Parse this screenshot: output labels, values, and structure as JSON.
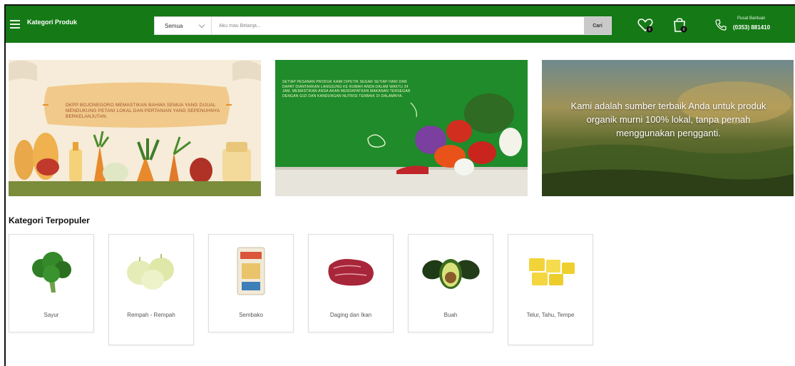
{
  "header": {
    "menu_label": "Kategori Produk",
    "search": {
      "category_value": "Semua",
      "placeholder": "Aku mau Belanja...",
      "button_label": "Cari"
    },
    "help": {
      "title": "Pusat Bantuan",
      "phone": "(0353) 881410"
    }
  },
  "banners": {
    "banner1_text": "DKPP Bojonegoro memastikan bahwa semua yang dijual mendukung petani lokal dan pertanian yang sepenuhnya berkelanjutan.",
    "banner2_text": "Setiap pesanan produk kami dipetik segar setiap hari dan dapat diantarkan langsung ke rumah Anda dalam waktu 24 jam, memastikan Anda akan mendapatkan makanan tersegar dengan gizi dan kandungan nutrisi terbaik di dalamnya.",
    "banner3_text": "Kami adalah sumber terbaik Anda untuk produk organik murni 100% lokal, tanpa pernah menggunakan pengganti."
  },
  "categories": {
    "title": "Kategori Terpopuler",
    "items": [
      {
        "label": "Sayur",
        "icon": "broccoli-icon"
      },
      {
        "label": "Rempah - Rempah",
        "icon": "onion-icon"
      },
      {
        "label": "Sembako",
        "icon": "rice-sack-icon"
      },
      {
        "label": "Daging dan Ikan",
        "icon": "meat-icon"
      },
      {
        "label": "Buah",
        "icon": "avocado-icon"
      },
      {
        "label": "Telur, Tahu, Tempe",
        "icon": "tofu-icon"
      }
    ]
  },
  "colors": {
    "primary_green": "#157a16",
    "search_button": "#c9c9c9"
  }
}
